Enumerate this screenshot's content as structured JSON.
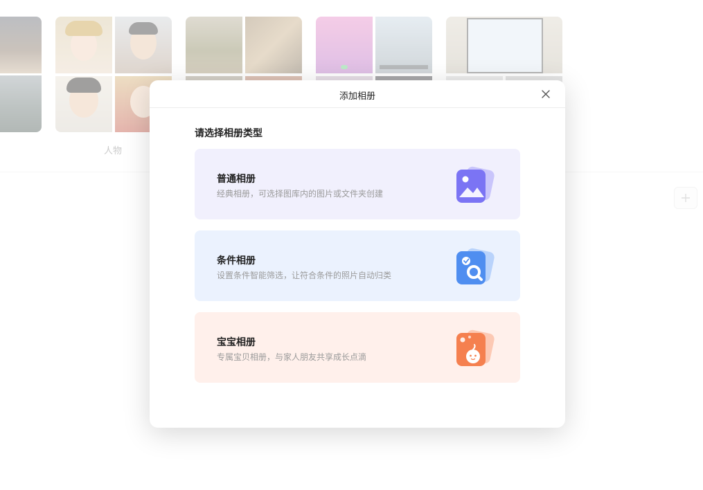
{
  "background": {
    "people_label": "人物",
    "add_icon": "plus-icon"
  },
  "dialog": {
    "title": "添加相册",
    "close_icon": "close-icon",
    "subtitle": "请选择相册类型",
    "options": [
      {
        "title": "普通相册",
        "desc": "经典相册，可选择图库内的图片或文件夹创建",
        "icon": "image-icon",
        "bg": "#f1f0fd",
        "accent": "#7b74f4"
      },
      {
        "title": "条件相册",
        "desc": "设置条件智能筛选，让符合条件的照片自动归类",
        "icon": "search-check-icon",
        "bg": "#ebf2fe",
        "accent": "#4f8ef0"
      },
      {
        "title": "宝宝相册",
        "desc": "专属宝贝相册，与家人朋友共享成长点滴",
        "icon": "baby-icon",
        "bg": "#fff0eb",
        "accent": "#f5804f"
      }
    ]
  }
}
